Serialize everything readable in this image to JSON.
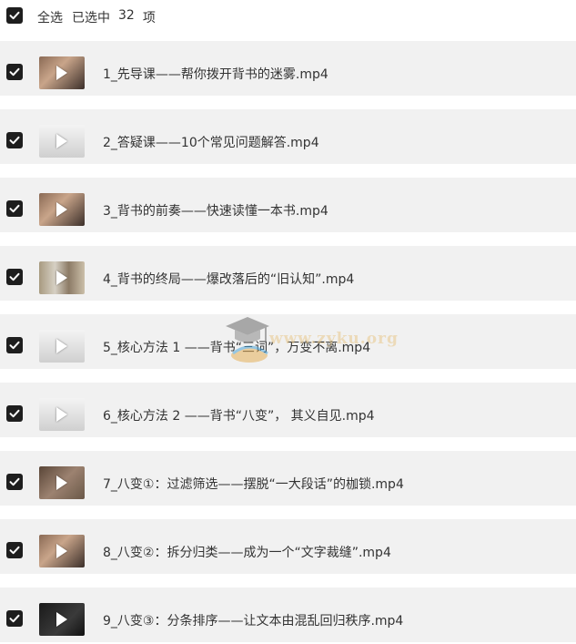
{
  "header": {
    "select_all_label": "全选",
    "selected_label": "已选中",
    "selected_count": "32",
    "unit_label": "项"
  },
  "files": [
    {
      "name": "1_先导课——帮你拨开背书的迷雾.mp4",
      "thumb": "person"
    },
    {
      "name": "2_答疑课——10个常见问题解答.mp4",
      "thumb": "document"
    },
    {
      "name": "3_背书的前奏——快速读懂一本书.mp4",
      "thumb": "person"
    },
    {
      "name": "4_背书的终局——爆改落后的“旧认知”.mp4",
      "thumb": "collage"
    },
    {
      "name": "5_核心方法 1 ——背书“三词”，万变不离.mp4",
      "thumb": "document"
    },
    {
      "name": "6_核心方法 2 ——背书“八变”， 其义自见.mp4",
      "thumb": "document"
    },
    {
      "name": "7_八变①：过滤筛选——摆脱“一大段话”的枷锁.mp4",
      "thumb": "room"
    },
    {
      "name": "8_八变②：拆分归类——成为一个“文字裁缝”.mp4",
      "thumb": "person"
    },
    {
      "name": "9_八变③：分条排序——让文本由混乱回归秩序.mp4",
      "thumb": "dark"
    }
  ],
  "watermark": {
    "text": "www.zyku.org"
  },
  "colors": {
    "checkbox": "#1e1e1e",
    "row_bg": "#f1f1f1",
    "text": "#333333"
  }
}
